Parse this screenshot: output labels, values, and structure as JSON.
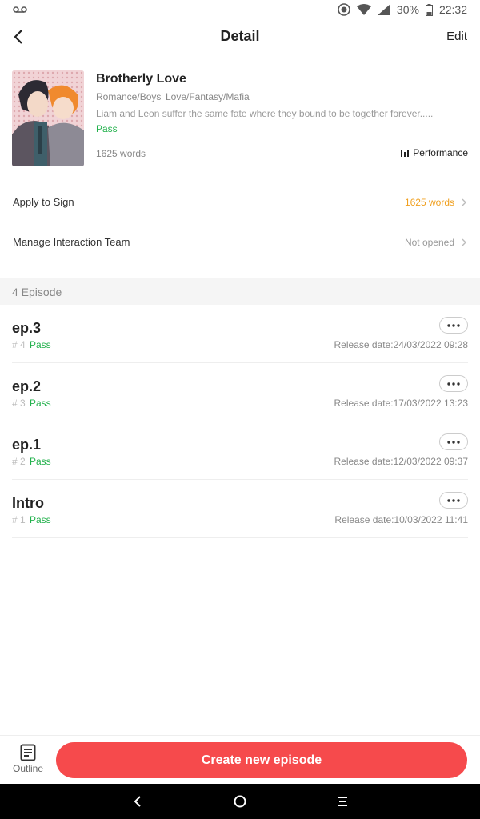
{
  "status_bar": {
    "battery": "30%",
    "time": "22:32",
    "icons": [
      "voicemail-icon",
      "do-not-disturb-icon",
      "wifi-icon",
      "signal-icon",
      "battery-icon"
    ]
  },
  "header": {
    "title": "Detail",
    "edit_label": "Edit"
  },
  "book": {
    "title": "Brotherly Love",
    "genres": "Romance/Boys' Love/Fantasy/Mafia",
    "description": "Liam and Leon suffer the same fate where they bound to be together forever.....",
    "status": "Pass",
    "words": "1625 words",
    "performance_label": "Performance"
  },
  "settings": [
    {
      "label": "Apply to Sign",
      "value": "1625 words",
      "value_color": "#f0a020"
    },
    {
      "label": "Manage Interaction Team",
      "value": "Not opened",
      "value_color": "#999999"
    }
  ],
  "episodes_header": "4 Episode",
  "episodes": [
    {
      "title": "ep.3",
      "number": "# 4",
      "status": "Pass",
      "release": "Release date:24/03/2022 09:28"
    },
    {
      "title": "ep.2",
      "number": "# 3",
      "status": "Pass",
      "release": "Release date:17/03/2022 13:23"
    },
    {
      "title": "ep.1",
      "number": "# 2",
      "status": "Pass",
      "release": "Release date:12/03/2022 09:37"
    },
    {
      "title": "Intro",
      "number": "# 1",
      "status": "Pass",
      "release": "Release date:10/03/2022 11:41"
    }
  ],
  "bottom": {
    "outline_label": "Outline",
    "create_label": "Create new episode"
  },
  "colors": {
    "accent": "#f64a4c",
    "pass": "#22b14c",
    "words": "#f0a020"
  }
}
